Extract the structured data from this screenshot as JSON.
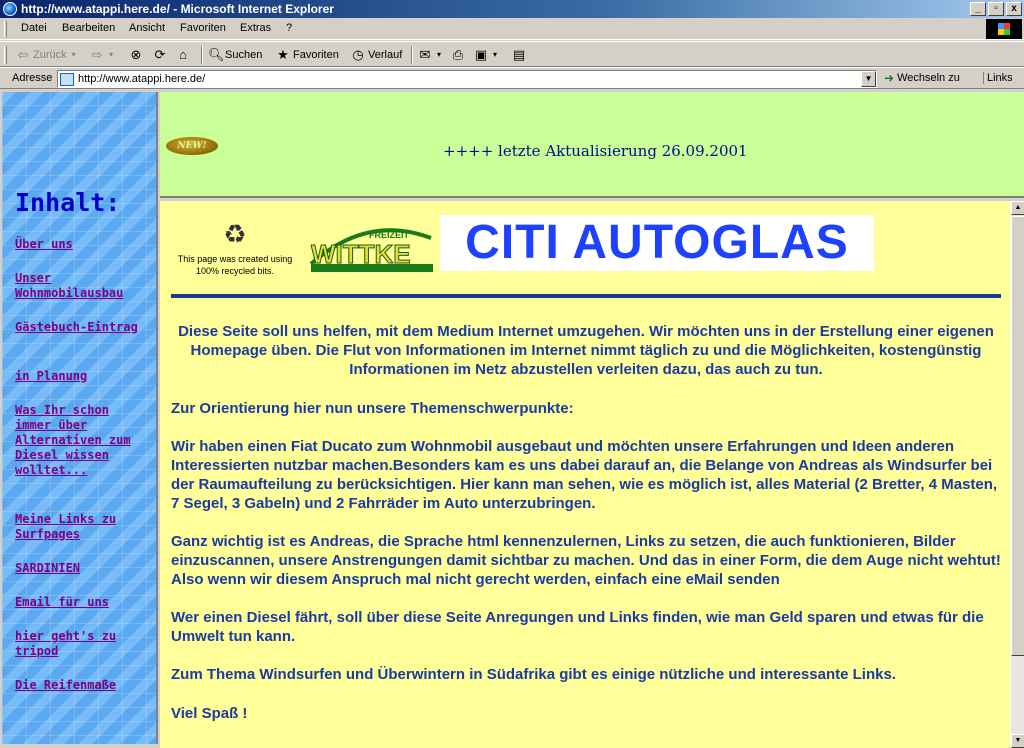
{
  "window": {
    "title": "http://www.atappi.here.de/ - Microsoft Internet Explorer",
    "minimize": "_",
    "maximize": "▫",
    "close": "x"
  },
  "menu": [
    "Datei",
    "Bearbeiten",
    "Ansicht",
    "Favoriten",
    "Extras",
    "?"
  ],
  "toolbar": {
    "back": "Zurück",
    "search": "Suchen",
    "favorites": "Favoriten",
    "history": "Verlauf"
  },
  "address": {
    "label": "Adresse",
    "url": "http://www.atappi.here.de/",
    "go": "Wechseln zu",
    "links": "Links"
  },
  "sidebar": {
    "heading": "Inhalt:",
    "links": [
      "Über uns",
      "Unser Wohnmobilausbau",
      "Gästebuch-Eintrag",
      "in Planung",
      "Was Ihr schon immer über Alternativen zum Diesel wissen wolltet...",
      "Meine Links zu Surfpages",
      "SARDINIEN",
      "Email für uns",
      "hier geht's zu tripod",
      "Die Reifenmaße"
    ]
  },
  "top": {
    "new_badge": "NEW!",
    "update": "++++ letzte Aktualisierung 26.09.2001"
  },
  "main": {
    "recycle_text": "This page was created using 100% recycled bits.",
    "wittke_top": "FREIZEIT",
    "wittke_name": "WITTKE",
    "banner": "CITI AUTOGLAS",
    "intro": "Diese Seite soll uns helfen, mit dem Medium Internet umzugehen. Wir möchten uns in der Erstellung einer eigenen Homepage üben. Die Flut von Informationen im Internet nimmt täglich zu und die Möglichkeiten, kostengünstig Informationen im Netz abzustellen verleiten dazu, das auch zu tun.",
    "orientation": "Zur Orientierung hier nun unsere Themenschwerpunkte:",
    "p1": "Wir haben einen Fiat Ducato zum Wohnmobil ausgebaut und möchten unsere Erfahrungen und Ideen anderen Interessierten nutzbar machen.Besonders kam es uns dabei darauf an, die Belange von Andreas als Windsurfer bei der Raumaufteilung zu berücksichtigen. Hier kann man sehen, wie es möglich ist, alles Material (2 Bretter, 4 Masten, 7 Segel, 3 Gabeln) und 2 Fahrräder im Auto unterzubringen.",
    "p2": "Ganz wichtig ist es Andreas, die Sprache html kennenzulernen, Links zu setzen, die auch funktionieren, Bilder einzuscannen, unsere Anstrengungen damit sichtbar zu machen. Und das in einer Form, die dem Auge nicht wehtut! Also wenn wir diesem Anspruch mal nicht gerecht werden, einfach eine eMail senden",
    "p3": "Wer einen Diesel fährt, soll über diese Seite Anregungen und Links finden, wie man Geld sparen und etwas für die Umwelt tun kann.",
    "p4": "Zum Thema Windsurfen und Überwintern in Südafrika gibt es einige nützliche und interessante Links.",
    "p5": "Viel Spaß !"
  }
}
